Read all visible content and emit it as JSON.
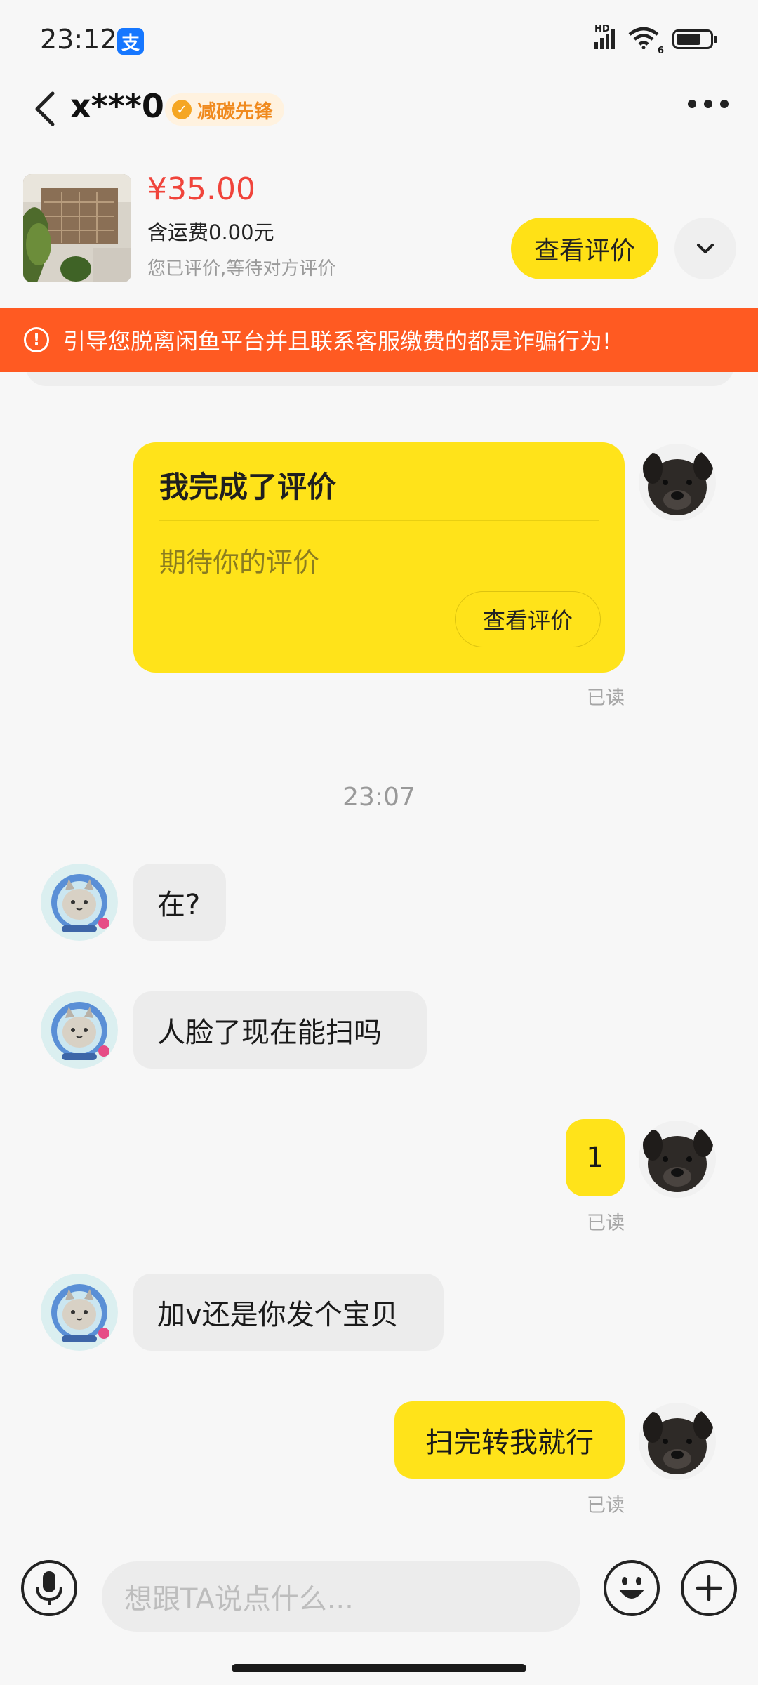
{
  "status_bar": {
    "time": "23:12",
    "alipay_glyph": "支",
    "network": "HD",
    "wifi_badge": "6"
  },
  "header": {
    "title": "x***0",
    "badge_label": "减碳先锋",
    "badge_color": "#f08a1e"
  },
  "product": {
    "price": "¥35.00",
    "shipping": "含运费0.00元",
    "review_status": "您已评价,等待对方评价",
    "view_review_label": "查看评价",
    "price_color": "#f0443b"
  },
  "warning": {
    "icon": "!",
    "text": "引导您脱离闲鱼平台并且联系客服缴费的都是诈骗行为!",
    "color": "#ff5a22"
  },
  "review_card": {
    "title": "我完成了评价",
    "subtitle": "期待你的评价",
    "button_label": "查看评价",
    "read_label": "已读"
  },
  "time_divider": "23:07",
  "messages": [
    {
      "from": "other",
      "text": "在?"
    },
    {
      "from": "other",
      "text": "人脸了现在能扫吗"
    },
    {
      "from": "me",
      "text": "1",
      "read": "已读"
    },
    {
      "from": "other",
      "text": "加v还是你发个宝贝"
    },
    {
      "from": "me",
      "text": "扫完转我就行",
      "read": "已读"
    }
  ],
  "input_bar": {
    "placeholder": "想跟TA说点什么..."
  },
  "accent_color": "#ffe31a"
}
